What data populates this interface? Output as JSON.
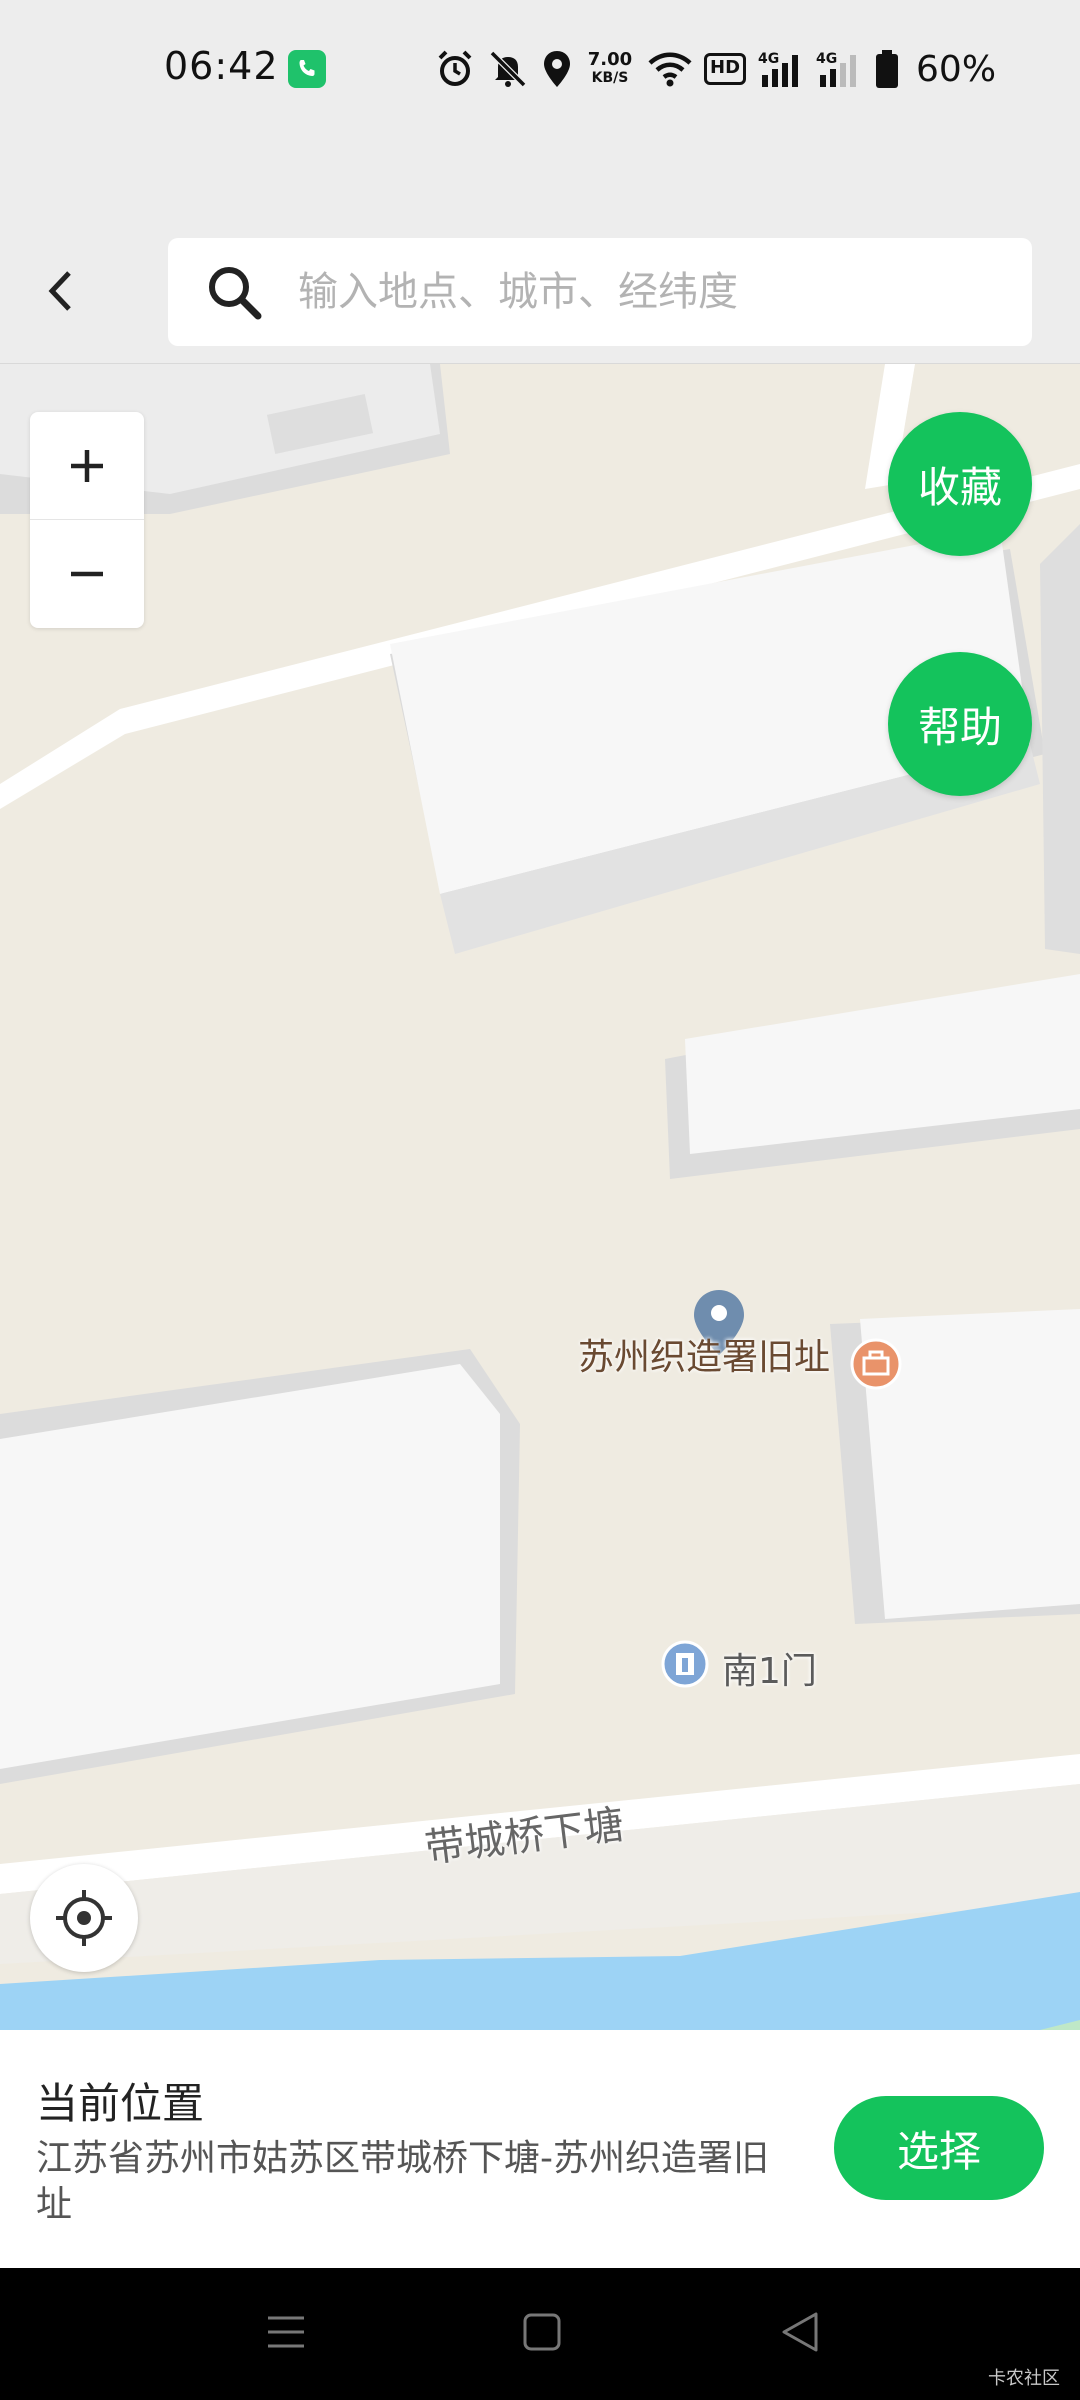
{
  "status_bar": {
    "time": "06:42",
    "net_speed_value": "7.00",
    "net_speed_unit": "KB/S",
    "hd_label": "HD",
    "signal_label": "4G",
    "battery": "60%",
    "icons": [
      "phone-call-icon",
      "alarm-icon",
      "mute-icon",
      "location-icon",
      "wifi-icon",
      "hd-volte-icon",
      "signal-4g-icon",
      "signal-4g-2-icon",
      "battery-icon"
    ]
  },
  "search": {
    "placeholder": "输入地点、城市、经纬度"
  },
  "map": {
    "zoom_in_label": "+",
    "zoom_out_label": "−",
    "favorite_label": "收藏",
    "help_label": "帮助",
    "poi_main": "苏州织造署旧址",
    "poi_gate": "南1门",
    "road_name": "带城桥下塘"
  },
  "bottom_sheet": {
    "title": "当前位置",
    "address": "江苏省苏州市姑苏区带城桥下塘-苏州织造署旧址",
    "select_label": "选择"
  },
  "nav_bar": {
    "icons": [
      "menu-icon",
      "home-icon",
      "back-triangle-icon"
    ]
  },
  "watermark": "卡农社区",
  "colors": {
    "accent": "#14c35c",
    "map_ground": "#efebe1",
    "water": "#9dd3f5"
  }
}
